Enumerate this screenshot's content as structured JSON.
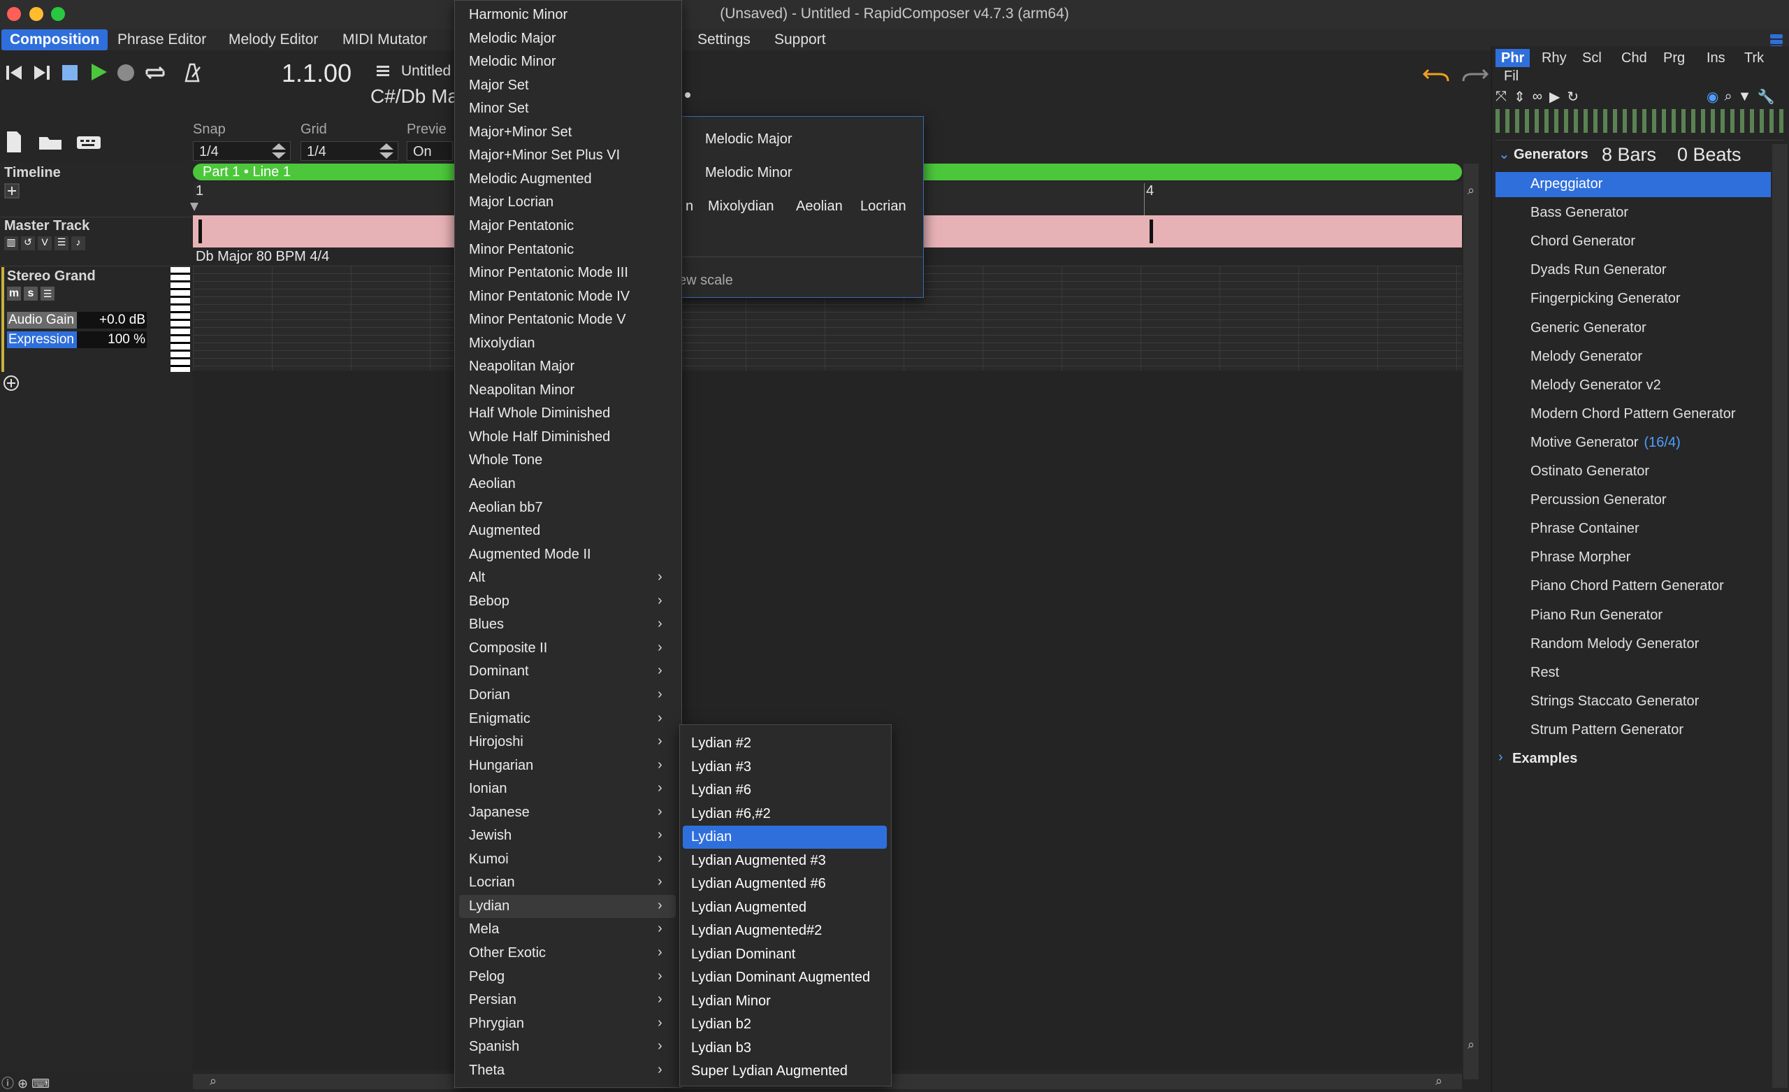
{
  "window": {
    "title": "(Unsaved) - Untitled - RapidComposer v4.7.3 (arm64)"
  },
  "menubar": {
    "items": [
      {
        "label": "Composition",
        "active": true
      },
      {
        "label": "Phrase Editor"
      },
      {
        "label": "Melody Editor"
      },
      {
        "label": "MIDI Mutator"
      },
      {
        "label": "Settings"
      },
      {
        "label": "Support"
      }
    ]
  },
  "transport": {
    "position": "1.1.00",
    "song_name": "Untitled",
    "song_key": "C#/Db Ma"
  },
  "controls": {
    "snap_label": "Snap",
    "snap_value": "1/4",
    "grid_label": "Grid",
    "grid_value": "1/4",
    "preview_label": "Previe",
    "preview_value": "On"
  },
  "timeline": {
    "label": "Timeline",
    "part_label": "Part 1 • Line 1",
    "bar1": "1",
    "bar4": "4"
  },
  "master": {
    "label": "Master Track",
    "info": "Db Major 80 BPM 4/4"
  },
  "track": {
    "name": "Stereo Grand",
    "btn_m": "m",
    "btn_s": "s",
    "audio_gain_label": "Audio Gain",
    "audio_gain_value": "+0.0 dB",
    "expression_label": "Expression",
    "expression_value": "100 %"
  },
  "scale_menu": {
    "items": [
      {
        "label": "Harmonic Minor"
      },
      {
        "label": "Melodic Major"
      },
      {
        "label": "Melodic Minor"
      },
      {
        "label": "Major Set"
      },
      {
        "label": "Minor Set"
      },
      {
        "label": "Major+Minor Set"
      },
      {
        "label": "Major+Minor Set Plus VI"
      },
      {
        "label": "Melodic Augmented"
      },
      {
        "label": "Major Locrian"
      },
      {
        "label": "Major Pentatonic"
      },
      {
        "label": "Minor Pentatonic"
      },
      {
        "label": "Minor Pentatonic Mode III"
      },
      {
        "label": "Minor Pentatonic Mode IV"
      },
      {
        "label": "Minor Pentatonic Mode V"
      },
      {
        "label": "Mixolydian"
      },
      {
        "label": "Neapolitan Major"
      },
      {
        "label": "Neapolitan Minor"
      },
      {
        "label": "Half Whole Diminished"
      },
      {
        "label": "Whole Half Diminished"
      },
      {
        "label": "Whole Tone"
      },
      {
        "label": "Aeolian"
      },
      {
        "label": "Aeolian bb7"
      },
      {
        "label": "Augmented"
      },
      {
        "label": "Augmented Mode II"
      },
      {
        "label": "Alt",
        "submenu": true
      },
      {
        "label": "Bebop",
        "submenu": true
      },
      {
        "label": "Blues",
        "submenu": true
      },
      {
        "label": "Composite II",
        "submenu": true
      },
      {
        "label": "Dominant",
        "submenu": true
      },
      {
        "label": "Dorian",
        "submenu": true
      },
      {
        "label": "Enigmatic",
        "submenu": true
      },
      {
        "label": "Hirojoshi",
        "submenu": true
      },
      {
        "label": "Hungarian",
        "submenu": true
      },
      {
        "label": "Ionian",
        "submenu": true
      },
      {
        "label": "Japanese",
        "submenu": true
      },
      {
        "label": "Jewish",
        "submenu": true
      },
      {
        "label": "Kumoi",
        "submenu": true
      },
      {
        "label": "Locrian",
        "submenu": true
      },
      {
        "label": "Lydian",
        "submenu": true,
        "highlighted": true
      },
      {
        "label": "Mela",
        "submenu": true
      },
      {
        "label": "Other Exotic",
        "submenu": true
      },
      {
        "label": "Pelog",
        "submenu": true
      },
      {
        "label": "Persian",
        "submenu": true
      },
      {
        "label": "Phrygian",
        "submenu": true
      },
      {
        "label": "Spanish",
        "submenu": true
      },
      {
        "label": "Theta",
        "submenu": true
      }
    ]
  },
  "lydian_submenu": {
    "items": [
      {
        "label": "Lydian #2"
      },
      {
        "label": "Lydian #3"
      },
      {
        "label": "Lydian #6"
      },
      {
        "label": "Lydian #6,#2"
      },
      {
        "label": "Lydian",
        "selected": true
      },
      {
        "label": "Lydian Augmented #3"
      },
      {
        "label": "Lydian Augmented #6"
      },
      {
        "label": "Lydian Augmented"
      },
      {
        "label": "Lydian Augmented#2"
      },
      {
        "label": "Lydian Dominant"
      },
      {
        "label": "Lydian Dominant Augmented"
      },
      {
        "label": "Lydian Minor"
      },
      {
        "label": "Lydian b2"
      },
      {
        "label": "Lydian b3"
      },
      {
        "label": "Super Lydian Augmented"
      }
    ]
  },
  "scale_popup": {
    "melodic_major": "Melodic Major",
    "melodic_minor": "Melodic Minor",
    "modes": [
      "n",
      "Mixolydian",
      "Aeolian",
      "Locrian"
    ],
    "new_scale": "ew scale"
  },
  "right_panel": {
    "tabs": [
      "Phr",
      "Rhy",
      "Scl",
      "Chd",
      "Prg",
      "Ins",
      "Trk"
    ],
    "tab2": "Fil",
    "generators_label": "Generators",
    "bars": "8 Bars",
    "beats": "0 Beats",
    "generators": [
      {
        "label": "Arpeggiator",
        "selected": true
      },
      {
        "label": "Bass Generator"
      },
      {
        "label": "Chord Generator"
      },
      {
        "label": "Dyads Run Generator"
      },
      {
        "label": "Fingerpicking Generator"
      },
      {
        "label": "Generic Generator"
      },
      {
        "label": "Melody Generator"
      },
      {
        "label": "Melody Generator v2"
      },
      {
        "label": "Modern Chord Pattern Generator"
      },
      {
        "label": "Motive Generator",
        "suffix": "(16/4)"
      },
      {
        "label": "Ostinato Generator"
      },
      {
        "label": "Percussion Generator"
      },
      {
        "label": "Phrase Container"
      },
      {
        "label": "Phrase Morpher"
      },
      {
        "label": "Piano Chord Pattern Generator"
      },
      {
        "label": "Piano Run Generator"
      },
      {
        "label": "Random Melody Generator"
      },
      {
        "label": "Rest"
      },
      {
        "label": "Strings Staccato Generator"
      },
      {
        "label": "Strum Pattern Generator"
      }
    ],
    "examples_label": "Examples"
  },
  "colors": {
    "accent": "#2f6fdc",
    "part_bar": "#4cc73b",
    "master_bar": "#e7b2b6",
    "undo": "#f0a020"
  }
}
